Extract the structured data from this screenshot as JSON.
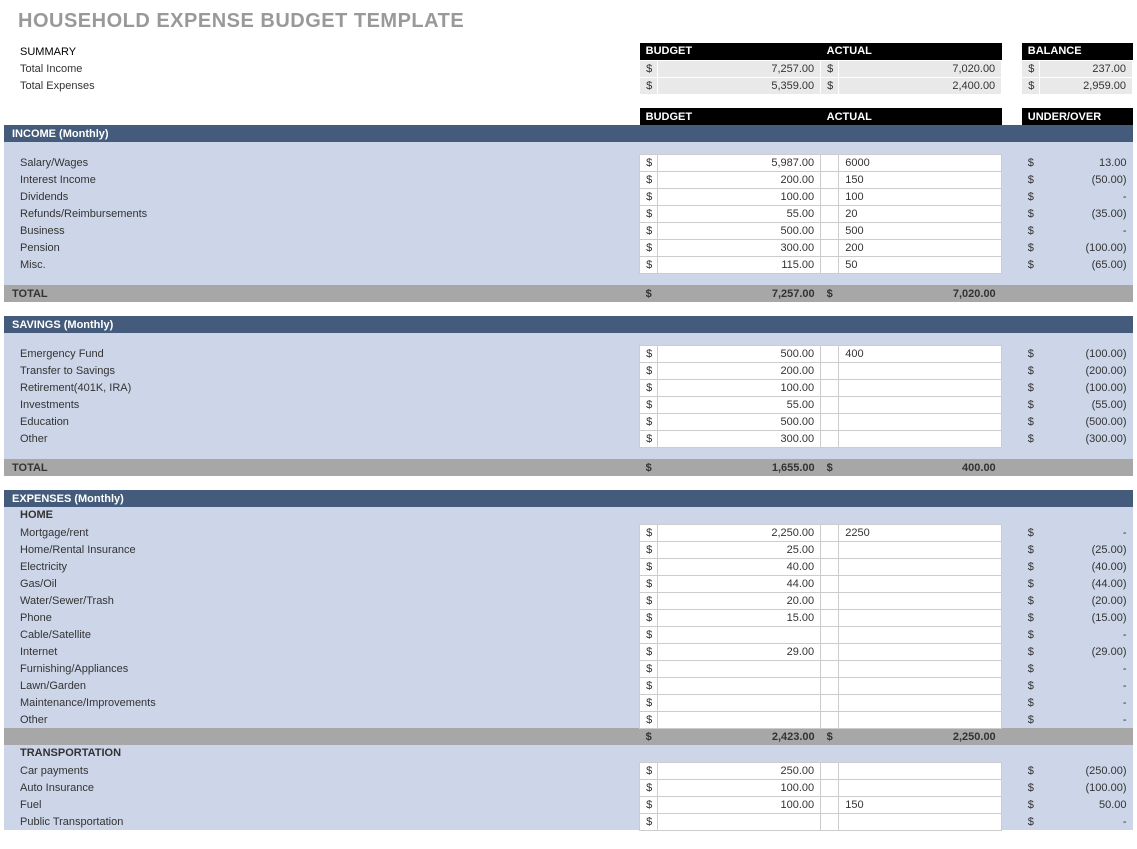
{
  "title": "HOUSEHOLD EXPENSE BUDGET TEMPLATE",
  "dollar": "$",
  "headers": {
    "budget": "BUDGET",
    "actual": "ACTUAL",
    "balance": "BALANCE",
    "under_over": "UNDER/OVER"
  },
  "summary": {
    "label": "SUMMARY",
    "rows": [
      {
        "label": "Total Income",
        "budget": "7,257.00",
        "actual": "7,020.00",
        "balance": "237.00"
      },
      {
        "label": "Total Expenses",
        "budget": "5,359.00",
        "actual": "2,400.00",
        "balance": "2,959.00"
      }
    ]
  },
  "sections": [
    {
      "title": "INCOME (Monthly)",
      "items": [
        {
          "label": "Salary/Wages",
          "budget": "5,987.00",
          "actual": "6000",
          "diff": "13.00"
        },
        {
          "label": "Interest Income",
          "budget": "200.00",
          "actual": "150",
          "diff": "(50.00)"
        },
        {
          "label": "Dividends",
          "budget": "100.00",
          "actual": "100",
          "diff": "-"
        },
        {
          "label": "Refunds/Reimbursements",
          "budget": "55.00",
          "actual": "20",
          "diff": "(35.00)"
        },
        {
          "label": "Business",
          "budget": "500.00",
          "actual": "500",
          "diff": "-"
        },
        {
          "label": "Pension",
          "budget": "300.00",
          "actual": "200",
          "diff": "(100.00)"
        },
        {
          "label": "Misc.",
          "budget": "115.00",
          "actual": "50",
          "diff": "(65.00)"
        }
      ],
      "total": {
        "label": "TOTAL",
        "budget": "7,257.00",
        "actual": "7,020.00"
      }
    },
    {
      "title": "SAVINGS (Monthly)",
      "items": [
        {
          "label": "Emergency Fund",
          "budget": "500.00",
          "actual": "400",
          "diff": "(100.00)"
        },
        {
          "label": "Transfer to Savings",
          "budget": "200.00",
          "actual": "",
          "diff": "(200.00)"
        },
        {
          "label": "Retirement(401K, IRA)",
          "budget": "100.00",
          "actual": "",
          "diff": "(100.00)"
        },
        {
          "label": "Investments",
          "budget": "55.00",
          "actual": "",
          "diff": "(55.00)"
        },
        {
          "label": "Education",
          "budget": "500.00",
          "actual": "",
          "diff": "(500.00)"
        },
        {
          "label": "Other",
          "budget": "300.00",
          "actual": "",
          "diff": "(300.00)"
        }
      ],
      "total": {
        "label": "TOTAL",
        "budget": "1,655.00",
        "actual": "400.00"
      }
    },
    {
      "title": "EXPENSES (Monthly)",
      "subs": [
        {
          "name": "HOME",
          "items": [
            {
              "label": "Mortgage/rent",
              "budget": "2,250.00",
              "actual": "2250",
              "diff": "-"
            },
            {
              "label": "Home/Rental Insurance",
              "budget": "25.00",
              "actual": "",
              "diff": "(25.00)"
            },
            {
              "label": "Electricity",
              "budget": "40.00",
              "actual": "",
              "diff": "(40.00)"
            },
            {
              "label": "Gas/Oil",
              "budget": "44.00",
              "actual": "",
              "diff": "(44.00)"
            },
            {
              "label": "Water/Sewer/Trash",
              "budget": "20.00",
              "actual": "",
              "diff": "(20.00)"
            },
            {
              "label": "Phone",
              "budget": "15.00",
              "actual": "",
              "diff": "(15.00)"
            },
            {
              "label": "Cable/Satellite",
              "budget": "",
              "actual": "",
              "diff": "-"
            },
            {
              "label": "Internet",
              "budget": "29.00",
              "actual": "",
              "diff": "(29.00)"
            },
            {
              "label": "Furnishing/Appliances",
              "budget": "",
              "actual": "",
              "diff": "-"
            },
            {
              "label": "Lawn/Garden",
              "budget": "",
              "actual": "",
              "diff": "-"
            },
            {
              "label": "Maintenance/Improvements",
              "budget": "",
              "actual": "",
              "diff": "-"
            },
            {
              "label": "Other",
              "budget": "",
              "actual": "",
              "diff": "-"
            }
          ],
          "total": {
            "budget": "2,423.00",
            "actual": "2,250.00"
          }
        },
        {
          "name": "TRANSPORTATION",
          "items": [
            {
              "label": "Car payments",
              "budget": "250.00",
              "actual": "",
              "diff": "(250.00)"
            },
            {
              "label": "Auto Insurance",
              "budget": "100.00",
              "actual": "",
              "diff": "(100.00)"
            },
            {
              "label": "Fuel",
              "budget": "100.00",
              "actual": "150",
              "diff": "50.00"
            },
            {
              "label": "Public Transportation",
              "budget": "",
              "actual": "",
              "diff": "-"
            }
          ]
        }
      ]
    }
  ]
}
